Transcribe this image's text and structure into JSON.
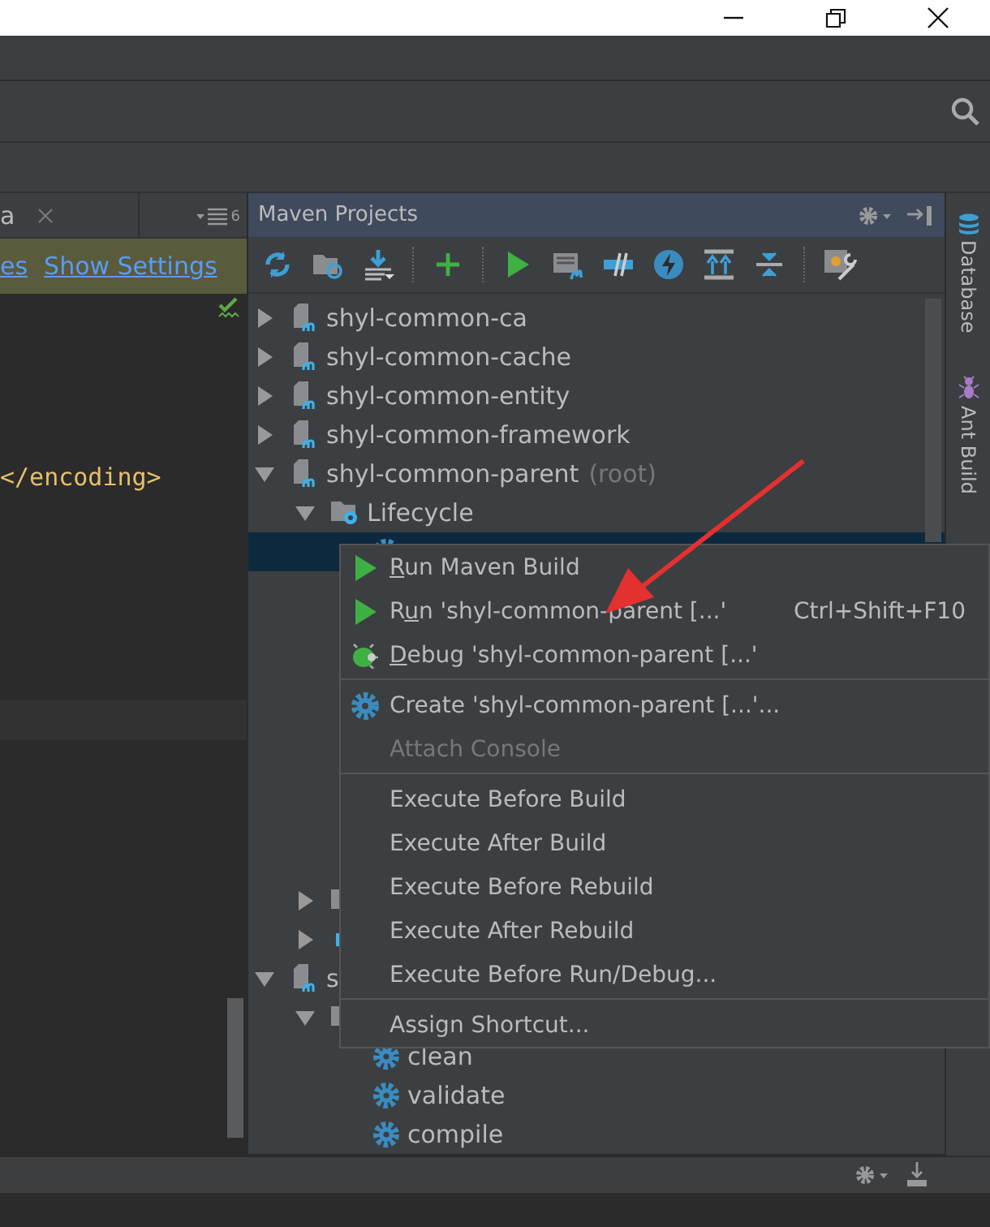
{
  "editor_tabs": [
    {
      "label": "a",
      "selected": true
    }
  ],
  "tab_count": "6",
  "banner": {
    "links": [
      "es",
      "Show Settings"
    ]
  },
  "code_lines": [
    "</encoding>"
  ],
  "maven_panel": {
    "title": "Maven Projects"
  },
  "tree": [
    {
      "label": "shyl-common-ca",
      "kind": "module",
      "expanded": false
    },
    {
      "label": "shyl-common-cache",
      "kind": "module",
      "expanded": false
    },
    {
      "label": "shyl-common-entity",
      "kind": "module",
      "expanded": false
    },
    {
      "label": "shyl-common-framework",
      "kind": "module",
      "expanded": false
    },
    {
      "label": "shyl-common-parent",
      "note": "(root)",
      "kind": "module",
      "expanded": true,
      "children": [
        {
          "label": "Lifecycle",
          "kind": "lifecycle",
          "expanded": true,
          "children": [
            {
              "kind": "goal",
              "selected": true
            }
          ]
        },
        {
          "kind": "folder",
          "expanded": false
        },
        {
          "kind": "plugin",
          "expanded": false
        }
      ]
    },
    {
      "label": "s",
      "kind": "module",
      "expanded": true,
      "children": [
        {
          "kind": "lifecycle",
          "expanded": true,
          "children": [
            {
              "label": "clean",
              "kind": "goal",
              "selected": false
            },
            {
              "label": "validate",
              "kind": "goal",
              "selected": false
            },
            {
              "label": "compile",
              "kind": "goal",
              "selected": false
            }
          ]
        }
      ]
    }
  ],
  "context_menu": [
    {
      "kind": "run",
      "key": "R",
      "post": "un Maven Build",
      "disabled": false
    },
    {
      "kind": "run",
      "pre": "R",
      "key": "u",
      "post": "n 'shyl-common-parent [...'",
      "shortcut": "Ctrl+Shift+F10",
      "disabled": false
    },
    {
      "kind": "debug",
      "key": "D",
      "post": "ebug 'shyl-common-parent [...'",
      "disabled": false
    },
    {
      "kind": "separator"
    },
    {
      "kind": "create",
      "label": "Create 'shyl-common-parent [...'...",
      "disabled": false
    },
    {
      "kind": "plain",
      "label": "Attach Console",
      "disabled": true
    },
    {
      "kind": "separator"
    },
    {
      "kind": "plain",
      "label": "Execute Before Build",
      "disabled": false
    },
    {
      "kind": "plain",
      "label": "Execute After Build",
      "disabled": false
    },
    {
      "kind": "plain",
      "label": "Execute Before Rebuild",
      "disabled": false
    },
    {
      "kind": "plain",
      "label": "Execute After Rebuild",
      "disabled": false
    },
    {
      "kind": "plain",
      "label": "Execute Before Run/Debug...",
      "disabled": false
    },
    {
      "kind": "separator"
    },
    {
      "kind": "plain",
      "label": "Assign Shortcut...",
      "disabled": false
    }
  ],
  "side_tools": [
    "Database",
    "Ant Build"
  ]
}
